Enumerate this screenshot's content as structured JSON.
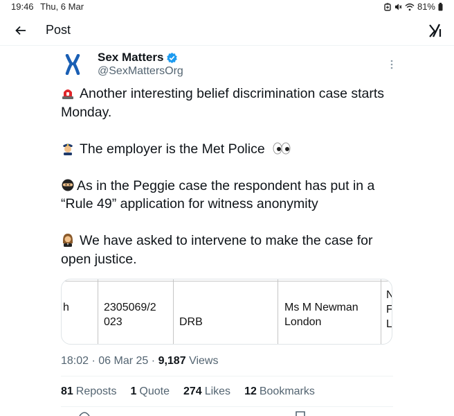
{
  "status_bar": {
    "time": "19:46",
    "date": "Thu, 6 Mar",
    "battery": "81%",
    "icons": [
      "battery-saver-icon",
      "mute-icon",
      "wifi-icon",
      "battery-icon"
    ]
  },
  "header": {
    "back_icon": "back-arrow-icon",
    "title": "Post",
    "logo_icon": "x-logo-icon"
  },
  "post": {
    "author": {
      "display_name": "Sex Matters",
      "handle": "@SexMattersOrg",
      "verified": true,
      "avatar_icon": "chromosome-logo"
    },
    "body": [
      {
        "emoji": "siren-emoji",
        "text": "Another interesting belief discrimination case starts Monday."
      },
      {
        "emoji": "police-officer-emoji",
        "text": "The employer is the Met Police",
        "trailing_emoji": "eyes-emoji"
      },
      {
        "emoji": "ninja-emoji",
        "text": "As in the Peggie case the respondent has put in a “Rule 49” application for witness anonymity"
      },
      {
        "emoji": "judge-emoji",
        "text": "We have asked  to intervene to make the case for open justice."
      }
    ],
    "media_table": {
      "col0": "h",
      "case_number_line1": "2305069/2",
      "case_number_line2": "023",
      "court_code": "DRB",
      "party_line1": "Ms M Newman",
      "party_line2": "London",
      "col4_line1": "N",
      "col4_line2": "F",
      "col4_line3": "L"
    },
    "meta": {
      "time": "18:02",
      "date": "06 Mar 25",
      "views_count": "9,187",
      "views_label": "Views"
    },
    "stats": [
      {
        "count": "81",
        "label": "Reposts"
      },
      {
        "count": "1",
        "label": "Quote"
      },
      {
        "count": "274",
        "label": "Likes"
      },
      {
        "count": "12",
        "label": "Bookmarks"
      }
    ],
    "colors": {
      "verified": "#1d9bf0",
      "avatar": "#1a5fb4",
      "text": "#0f1419",
      "muted": "#536471"
    }
  }
}
